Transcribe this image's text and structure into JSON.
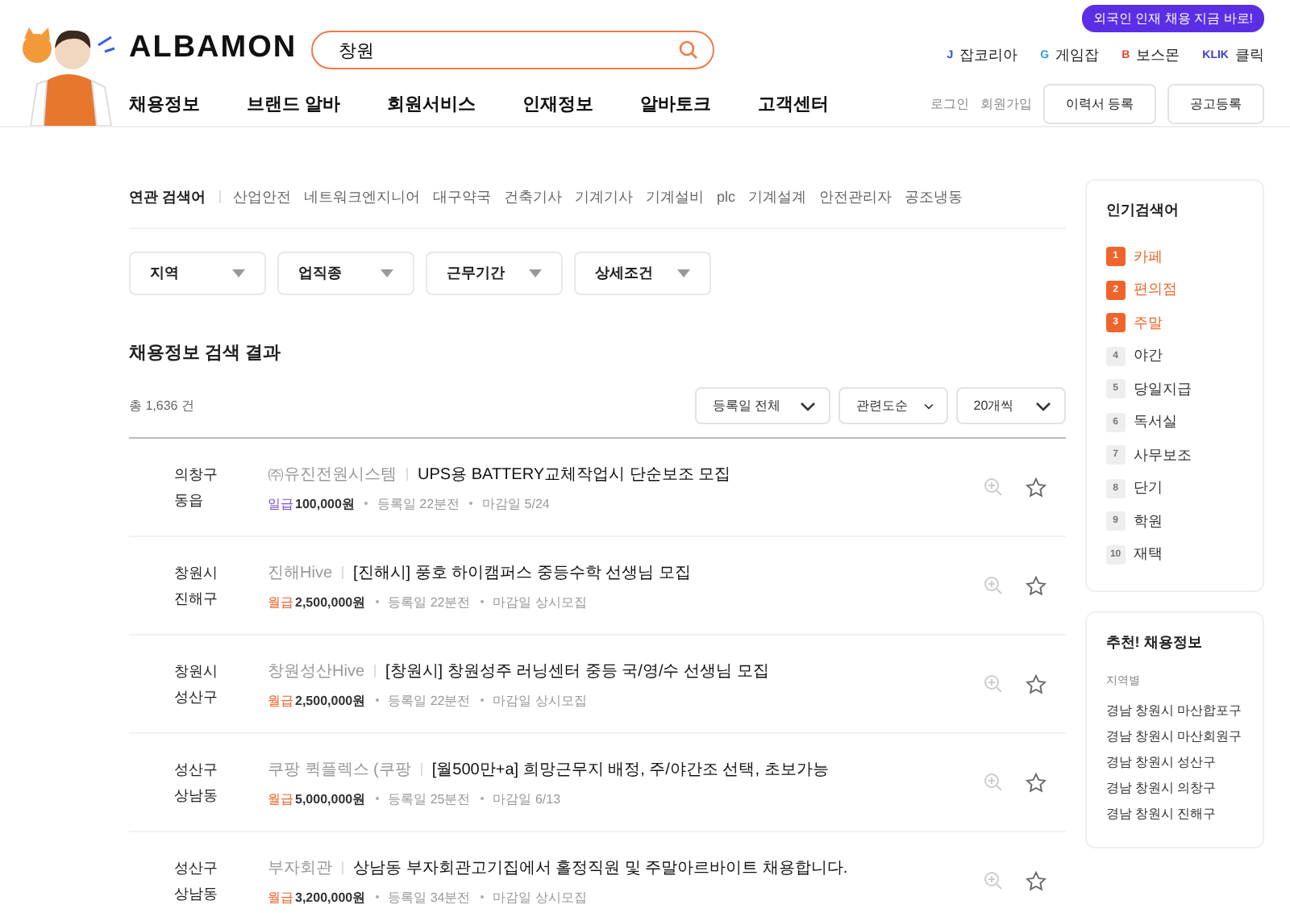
{
  "header": {
    "logo": "ALBAMON",
    "search": {
      "value": "창원"
    },
    "nav": [
      "채용정보",
      "브랜드 알바",
      "회원서비스",
      "인재정보",
      "알바토크",
      "고객센터"
    ],
    "promo_badge": "외국인 인재 채용 지금 바로!",
    "partner_links": [
      {
        "icon": "J",
        "label": "잡코리아",
        "color": "#2b4ee6"
      },
      {
        "icon": "G",
        "label": "게임잡",
        "color": "#2ba0e6"
      },
      {
        "icon": "B",
        "label": "보스몬",
        "color": "#e6452b"
      },
      {
        "icon": "KLIK",
        "label": "클릭",
        "color": "#3b3bd6"
      }
    ],
    "account_links": [
      "로그인",
      "회원가입"
    ],
    "buttons": [
      "이력서 등록",
      "공고등록"
    ]
  },
  "related": {
    "label": "연관 검색어",
    "terms": [
      "산업안전",
      "네트워크엔지니어",
      "대구약국",
      "건축기사",
      "기계기사",
      "기계설비",
      "plc",
      "기계설계",
      "안전관리자",
      "공조냉동"
    ]
  },
  "filters": [
    "지역",
    "업직종",
    "근무기간",
    "상세조건"
  ],
  "results": {
    "title": "채용정보 검색 결과",
    "count": "총 1,636 건",
    "sorts": [
      "등록일 전체",
      "관련도순",
      "20개씩"
    ],
    "rows": [
      {
        "location": [
          "의창구",
          "동읍"
        ],
        "company": "㈜유진전원시스템",
        "title": "UPS용 BATTERY교체작업시 단순보조 모집",
        "pay_type": "일급",
        "color": "#7b4fd6",
        "pay": "100,000원",
        "posted": "등록일 22분전",
        "deadline": "마감일 5/24",
        "starred": false
      },
      {
        "location": [
          "창원시",
          "진해구"
        ],
        "company": "진해Hive",
        "title": "[진해시] 풍호 하이캠퍼스 중등수학 선생님 모집",
        "pay_type": "월급",
        "color": "#f0642b",
        "pay": "2,500,000원",
        "posted": "등록일 22분전",
        "deadline": "마감일 상시모집",
        "starred": false
      },
      {
        "location": [
          "창원시",
          "성산구"
        ],
        "company": "창원성산Hive",
        "title": "[창원시] 창원성주 러닝센터 중등 국/영/수 선생님 모집",
        "pay_type": "월급",
        "color": "#f0642b",
        "pay": "2,500,000원",
        "posted": "등록일 22분전",
        "deadline": "마감일 상시모집",
        "starred": false
      },
      {
        "location": [
          "성산구",
          "상남동"
        ],
        "company": "쿠팡 퀵플렉스 (쿠팡",
        "title": "[월500만+a] 희망근무지 배정, 주/야간조 선택, 초보가능",
        "pay_type": "월급",
        "color": "#f0642b",
        "pay": "5,000,000원",
        "posted": "등록일 25분전",
        "deadline": "마감일 6/13",
        "starred": false
      },
      {
        "location": [
          "성산구",
          "상남동"
        ],
        "company": "부자회관",
        "title": "상남동 부자회관고기집에서 홀정직원 및 주말아르바이트 채용합니다.",
        "pay_type": "월급",
        "color": "#f0642b",
        "pay": "3,200,000원",
        "posted": "등록일 34분전",
        "deadline": "마감일 상시모집",
        "starred": false
      }
    ]
  },
  "popular": {
    "title": "인기검색어",
    "items": [
      {
        "rank": "1",
        "term": "카페",
        "highlighted": true
      },
      {
        "rank": "2",
        "term": "편의점",
        "highlighted": true
      },
      {
        "rank": "3",
        "term": "주말",
        "highlighted": true
      },
      {
        "rank": "4",
        "term": "야간",
        "highlighted": false
      },
      {
        "rank": "5",
        "term": "당일지급",
        "highlighted": false
      },
      {
        "rank": "6",
        "term": "독서실",
        "highlighted": false
      },
      {
        "rank": "7",
        "term": "사무보조",
        "highlighted": false
      },
      {
        "rank": "8",
        "term": "단기",
        "highlighted": false
      },
      {
        "rank": "9",
        "term": "학원",
        "highlighted": false
      },
      {
        "rank": "10",
        "term": "재택",
        "highlighted": false
      }
    ]
  },
  "recommended": {
    "title": "추천! 채용정보",
    "subtitle": "지역별",
    "links": [
      "경남 창원시 마산합포구",
      "경남 창원시 마산회원구",
      "경남 창원시 성산구",
      "경남 창원시 의창구",
      "경남 창원시 진해구"
    ]
  }
}
